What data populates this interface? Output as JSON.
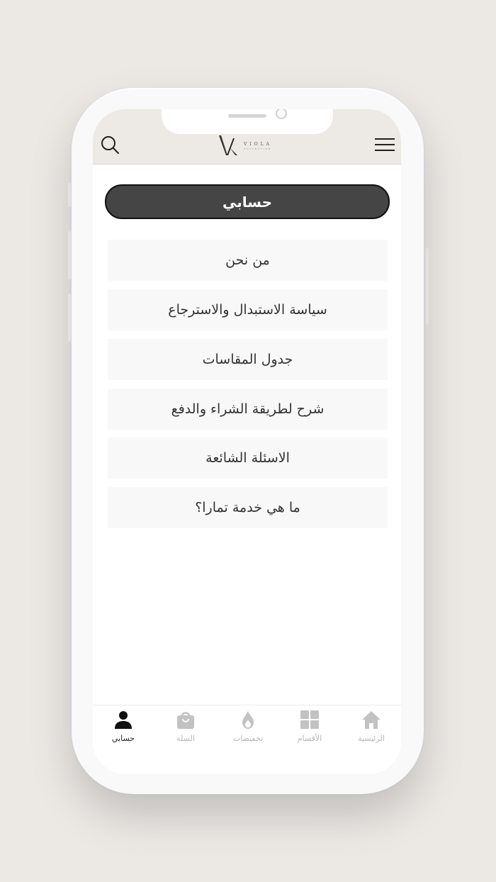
{
  "header": {
    "brand_name": "VIOLA",
    "brand_tagline": "COLLECTION",
    "menu_icon": "hamburger-icon",
    "search_icon": "search-icon"
  },
  "page": {
    "title": "حسابي"
  },
  "menu": {
    "items": [
      {
        "label": "من نحن"
      },
      {
        "label": "سياسة الاستبدال والاسترجاع"
      },
      {
        "label": "جدول المقاسات"
      },
      {
        "label": "شرح لطريقة الشراء والدفع"
      },
      {
        "label": "الاسئلة الشائعة"
      },
      {
        "label": "ما هي خدمة تمارا؟"
      }
    ]
  },
  "tabbar": {
    "active": "account",
    "tabs": [
      {
        "id": "account",
        "label": "حسابي",
        "icon": "user-icon"
      },
      {
        "id": "cart",
        "label": "السلة",
        "icon": "shopping-bag-icon"
      },
      {
        "id": "offers",
        "label": "تخفيضات",
        "icon": "flame-icon"
      },
      {
        "id": "categories",
        "label": "الأقسام",
        "icon": "grid-icon"
      },
      {
        "id": "home",
        "label": "الرئيسية",
        "icon": "home-icon"
      }
    ]
  },
  "colors": {
    "background": "#ece9e5",
    "header": "#ede9e4",
    "pill": "#454545",
    "menu_item_bg": "#f8f8f8",
    "active_tab": "#222222",
    "inactive_tab": "#b5b5b5"
  }
}
